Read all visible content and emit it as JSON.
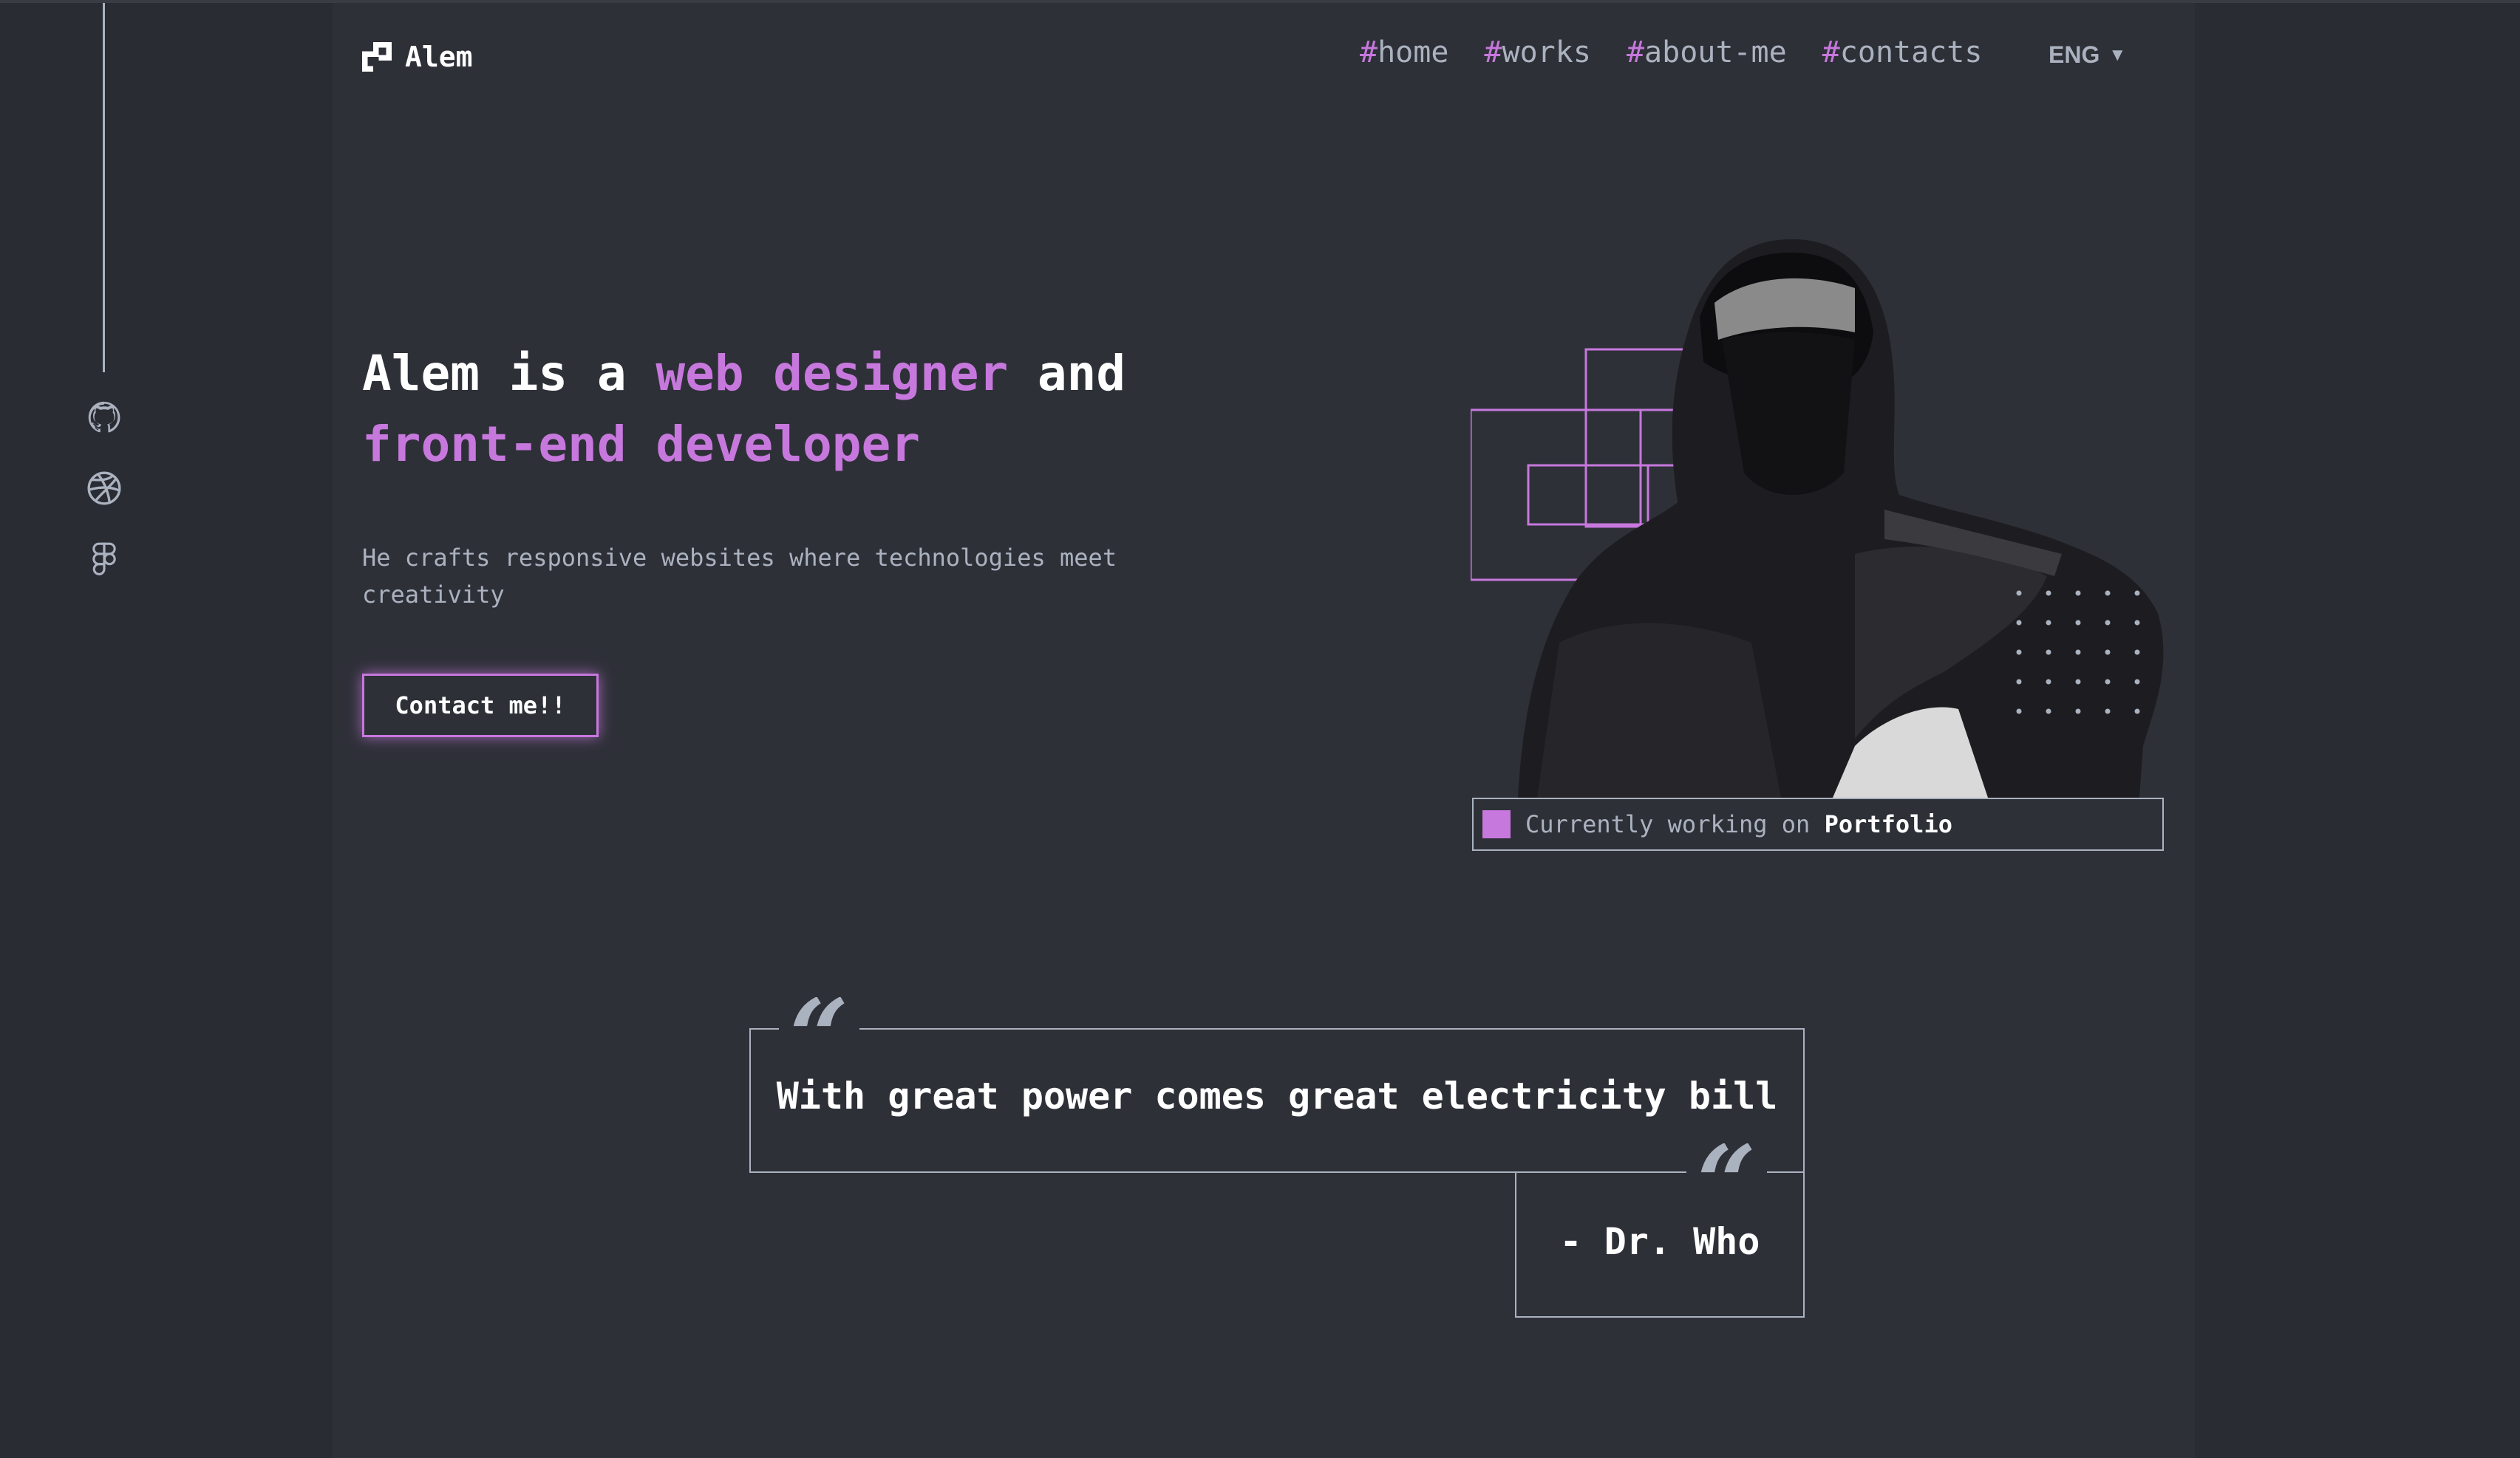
{
  "brand": {
    "name": "Alem"
  },
  "nav": {
    "items": [
      {
        "hash": "#",
        "label": "home"
      },
      {
        "hash": "#",
        "label": "works"
      },
      {
        "hash": "#",
        "label": "about-me"
      },
      {
        "hash": "#",
        "label": "contacts"
      }
    ],
    "language": "ENG",
    "language_caret": "▼"
  },
  "social": {
    "icons": [
      "github-icon",
      "dribbble-icon",
      "figma-icon"
    ]
  },
  "hero": {
    "title_part1": "Alem is a ",
    "title_accent1": "web designer",
    "title_part2": " and",
    "title_accent2": "front-end developer",
    "subtitle": "He crafts responsive websites where technologies meet creativity",
    "cta_label": "Contact me!!"
  },
  "status": {
    "prefix": "Currently working on ",
    "project": "Portfolio"
  },
  "quote": {
    "text": "With great power comes great electricity bill",
    "author": "- Dr. Who",
    "mark": "“"
  },
  "colors": {
    "accent": "#c778dd",
    "background": "#2e3038",
    "outer_background": "#2a2c33",
    "muted_text": "#abb2bf",
    "text": "#ffffff"
  }
}
